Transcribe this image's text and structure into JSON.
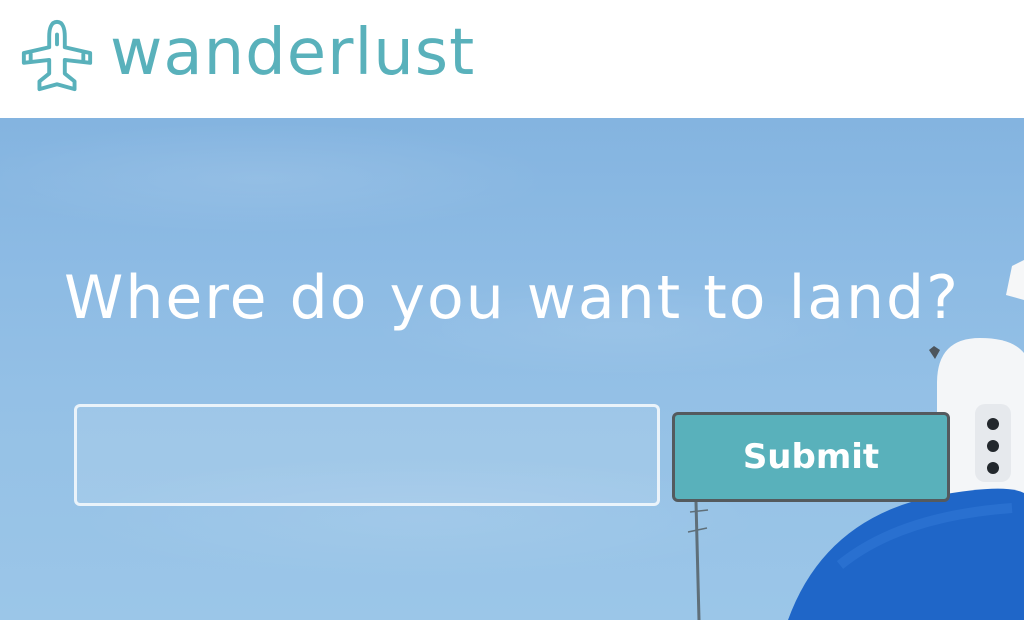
{
  "brand": {
    "name": "wanderlust",
    "logo_icon": "airplane-icon",
    "color": "#59b1bb"
  },
  "hero": {
    "title": "Where do you want to land?",
    "sky_color": "#8dbbe4",
    "dome_color": "#1f66c8"
  },
  "search": {
    "value": "",
    "placeholder": "",
    "submit_label": "Submit",
    "submit_color": "#59b1bb"
  }
}
